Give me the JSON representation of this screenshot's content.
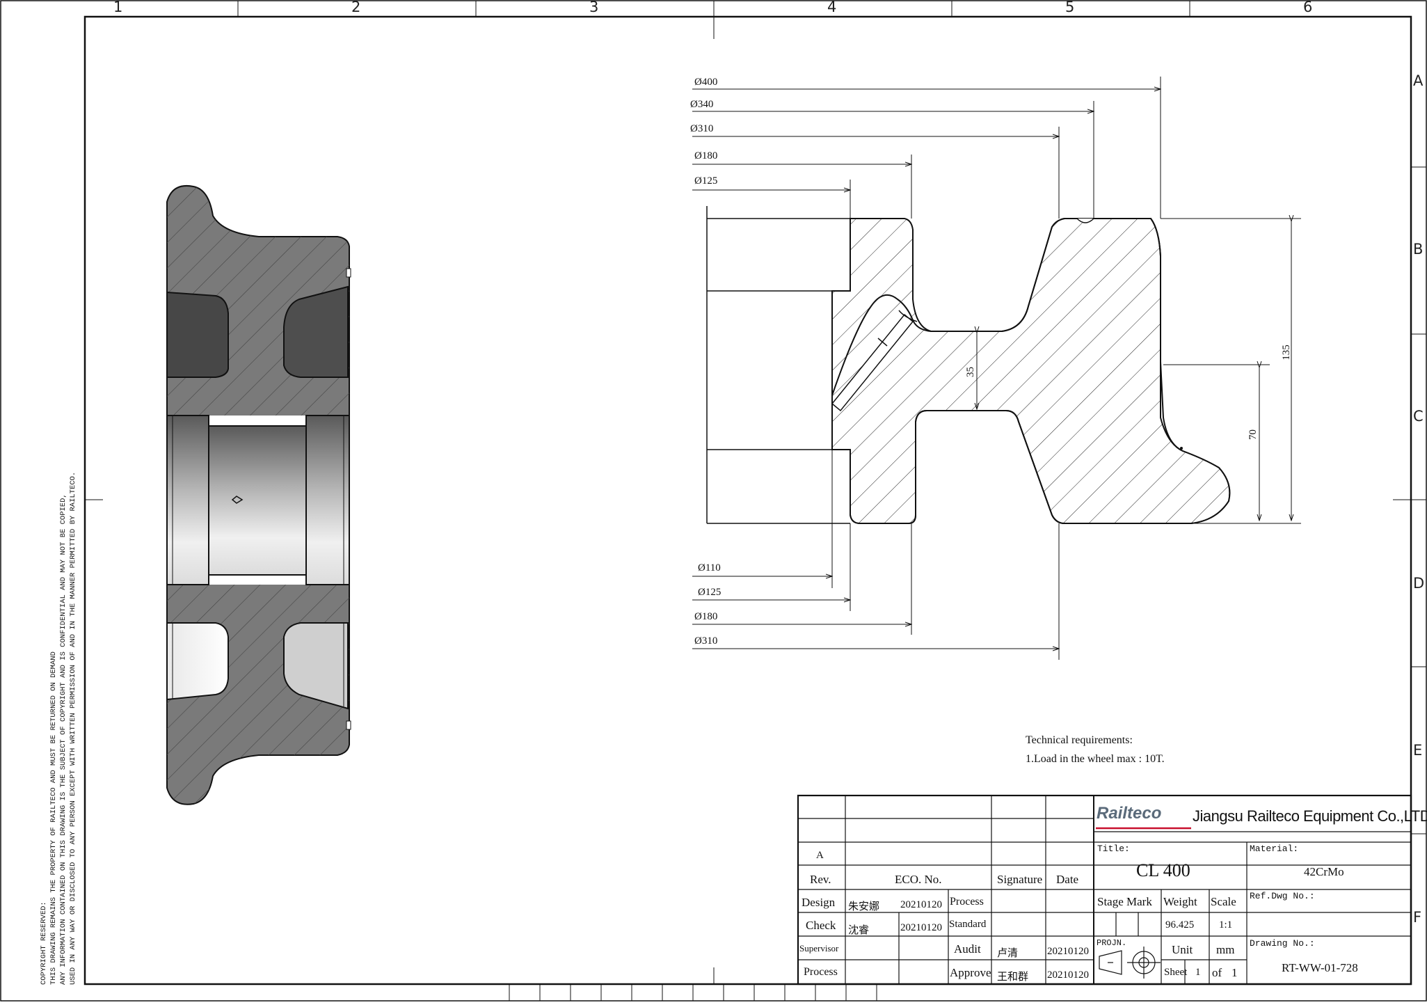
{
  "zones": {
    "columns": [
      "1",
      "2",
      "3",
      "4",
      "5",
      "6"
    ],
    "rows": [
      "A",
      "B",
      "C",
      "D",
      "E",
      "F"
    ]
  },
  "copyright": {
    "line1": "COPYRIGHT RESERVED:",
    "line2": "THIS DRAWING REMAINS THE PROPERTY OF RAILTECO AND MUST BE RETURNED ON DEMAND",
    "line3": "ANY INFORMATION CONTAINED ON THIS DRAWING IS THE SUBJECT OF COPYRIGHT AND IS CONFIDENTIAL AND MAY NOT BE COPIED,",
    "line4": "USED IN ANY WAY OR DISCLOSED TO ANY PERSON EXCEPT WITH WRITTEN PERMISSION OF AND IN THE MANNER PERMITTED BY RAILTECO."
  },
  "dimensions": {
    "top": [
      "Ø400",
      "Ø340",
      "Ø310",
      "Ø180",
      "Ø125"
    ],
    "bottom": [
      "Ø110",
      "Ø125",
      "Ø180",
      "Ø310"
    ],
    "height_total": "135",
    "height_flange": "70",
    "web_gap": "35"
  },
  "technical_requirements": {
    "heading": "Technical requirements:",
    "item1": "1.Load in the wheel max : 10T."
  },
  "title_block": {
    "company_logo": "Railteco",
    "company_name": "Jiangsu Railteco Equipment Co.,LTD",
    "rev_letter": "A",
    "headers": {
      "rev": "Rev.",
      "eco": "ECO. No.",
      "signature": "Signature",
      "date": "Date"
    },
    "rows": {
      "design_label": "Design",
      "design_name": "朱安娜",
      "design_date": "20210120",
      "check_label": "Check",
      "check_name": "沈睿",
      "check_date": "20210120",
      "supervisor_label": "Supervisor",
      "process_label": "Process",
      "process2_label": "Process",
      "standard_label": "Standard",
      "audit_label": "Audit",
      "audit_name": "卢清",
      "audit_date": "20210120",
      "approve_label": "Approve",
      "approve_name": "王和群",
      "approve_date": "20210120"
    },
    "title_label": "Title:",
    "title_value": "CL 400",
    "material_label": "Material:",
    "material_value": "42CrMo",
    "stage_mark_label": "Stage Mark",
    "weight_label": "Weight",
    "weight_value": "96.425",
    "scale_label": "Scale",
    "scale_value": "1:1",
    "ref_dwg_label": "Ref.Dwg No.:",
    "projn_label": "PROJN.",
    "unit_label": "Unit",
    "unit_value": "mm",
    "sheet_label": "Sheet",
    "sheet_value": "1",
    "of_label": "of",
    "of_value": "1",
    "drawing_no_label": "Drawing No.:",
    "drawing_no_value": "RT-WW-01-728"
  }
}
